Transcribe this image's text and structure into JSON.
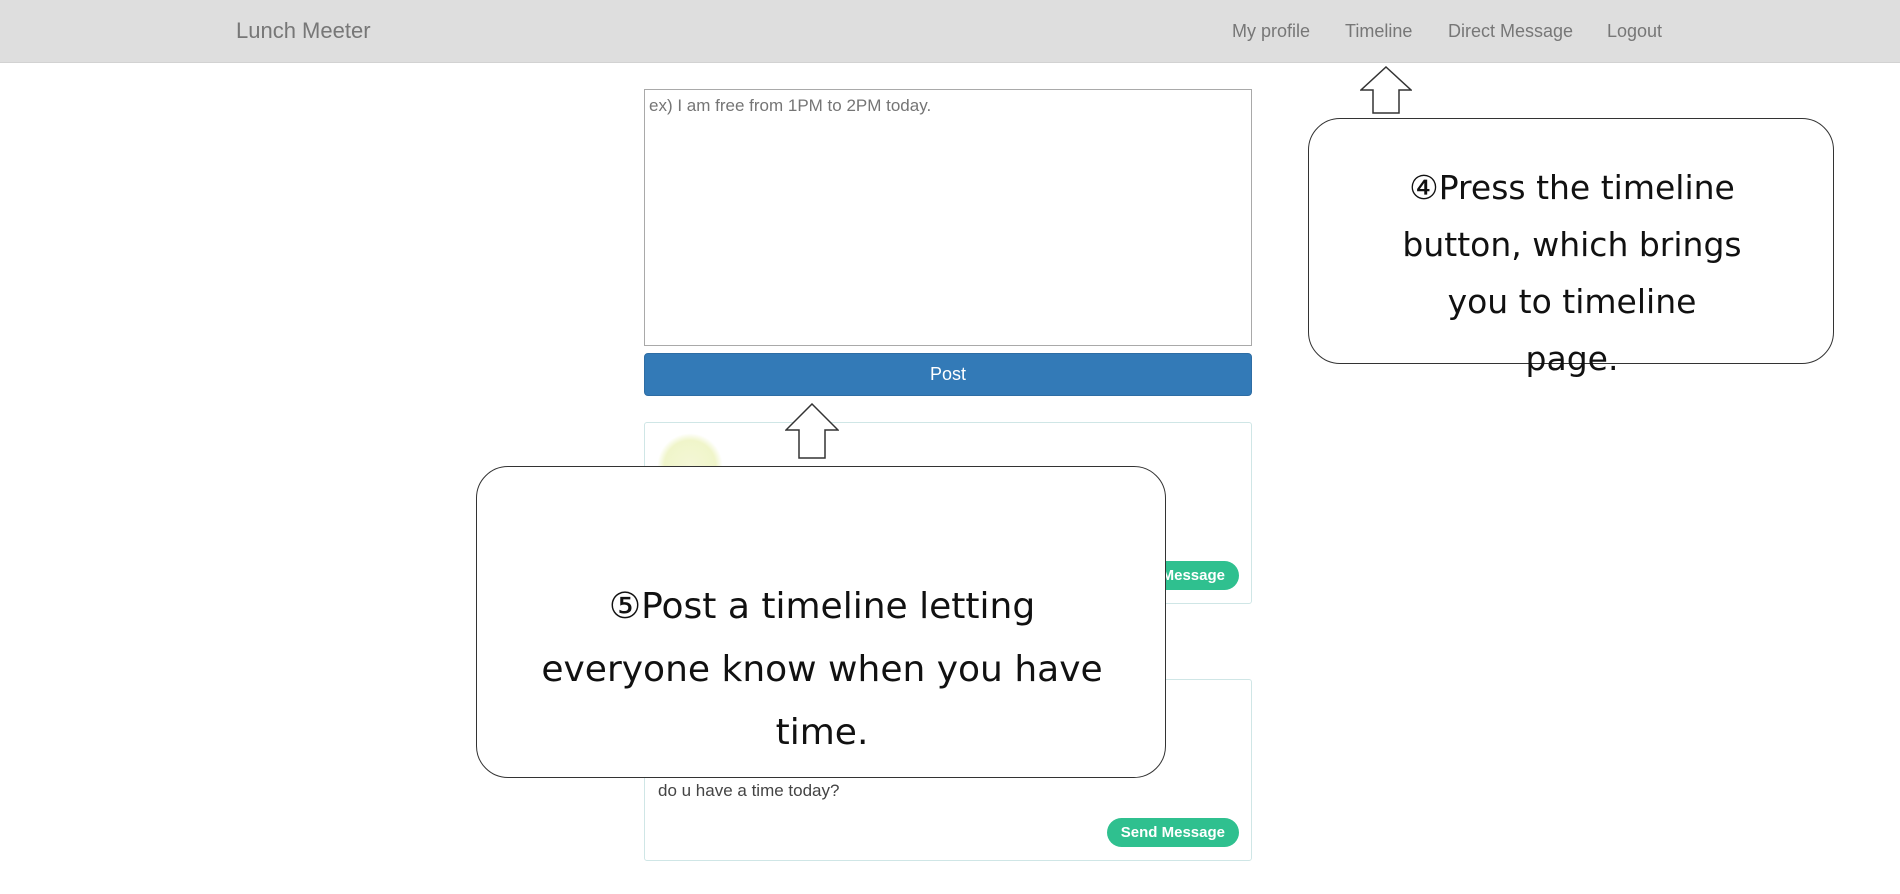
{
  "navbar": {
    "brand": "Lunch Meeter",
    "links": {
      "my_profile": "My profile",
      "timeline": "Timeline",
      "direct_message": "Direct Message",
      "logout": "Logout"
    }
  },
  "post_form": {
    "placeholder": "ex) I am free from 1PM to 2PM today.",
    "post_button": "Post"
  },
  "timeline": {
    "posts": [
      {
        "text": "",
        "send_button": "Send Message"
      },
      {
        "text": "do u have a time today?",
        "send_button": "Send Message"
      }
    ]
  },
  "annotations": {
    "step4": "④Press the timeline button, which brings you to timeline page.",
    "step5": "⑤Post a timeline letting  everyone know when you have time."
  },
  "colors": {
    "navbar_bg": "#dedede",
    "post_button": "#337ab7",
    "send_button": "#2fc08f"
  },
  "icons": {
    "arrow": "up-arrow-icon",
    "avatar": "avatar"
  }
}
